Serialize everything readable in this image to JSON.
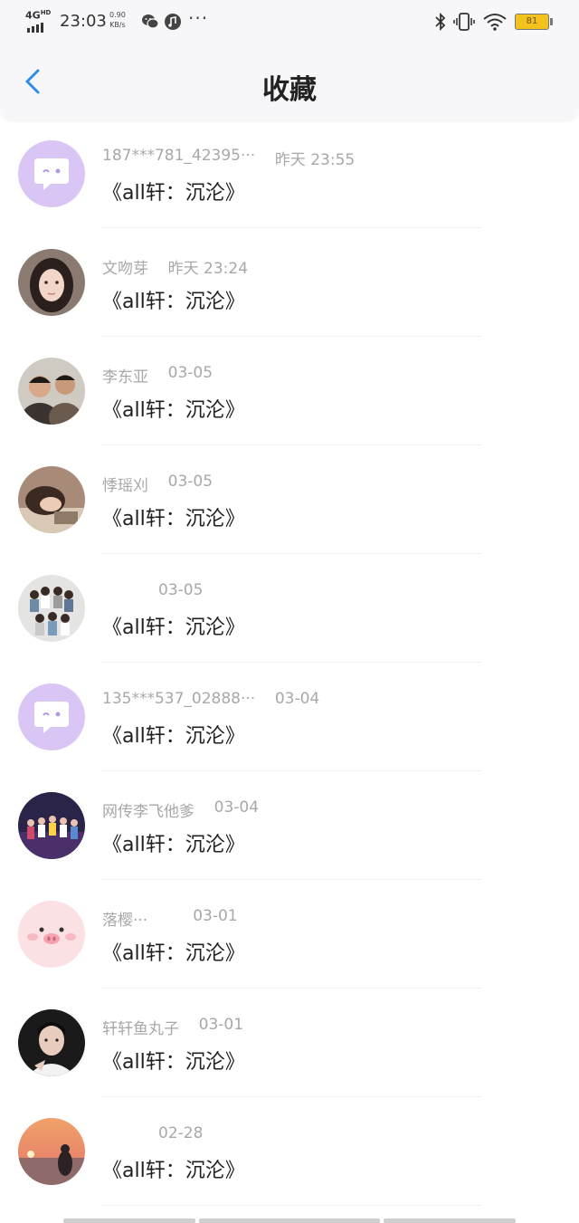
{
  "status_bar": {
    "network": "4G",
    "network_sup": "HD",
    "time": "23:03",
    "speed_value": "0.90",
    "speed_unit": "KB/s",
    "more": "···",
    "battery": "81",
    "battery_color": "#f3c21c"
  },
  "header": {
    "title": "收藏",
    "back_color": "#2d8cf0"
  },
  "items": [
    {
      "nick": "187***781_42395···",
      "time": "昨天 23:55",
      "title": "《all轩：沉沦》",
      "avatar": "chat-bubble-avatar"
    },
    {
      "nick": "文吻芽",
      "time": "昨天 23:24",
      "title": "《all轩：沉沦》",
      "avatar": "girl-portrait-avatar"
    },
    {
      "nick": "李东亚",
      "time": "03-05",
      "title": "《all轩：沉沦》",
      "avatar": "two-people-avatar"
    },
    {
      "nick": "悸瑶刈",
      "time": "03-05",
      "title": "《all轩：沉沦》",
      "avatar": "reclining-person-avatar"
    },
    {
      "nick": "",
      "time": "03-05",
      "title": "《all轩：沉沦》",
      "avatar": "group-photo-avatar"
    },
    {
      "nick": "135***537_02888···",
      "time": "03-04",
      "title": "《all轩：沉沦》",
      "avatar": "chat-bubble-avatar"
    },
    {
      "nick": "网传李飞他爹",
      "time": "03-04",
      "title": "《all轩：沉沦》",
      "avatar": "stage-group-avatar"
    },
    {
      "nick": "落樱···",
      "time": "03-01",
      "title": "《all轩：沉沦》",
      "avatar": "pig-face-avatar"
    },
    {
      "nick": "轩轩鱼丸子",
      "time": "03-01",
      "title": "《all轩：沉沦》",
      "avatar": "boy-portrait-avatar"
    },
    {
      "nick": "",
      "time": "02-28",
      "title": "《all轩：沉沦》",
      "avatar": "sunset-avatar"
    }
  ]
}
